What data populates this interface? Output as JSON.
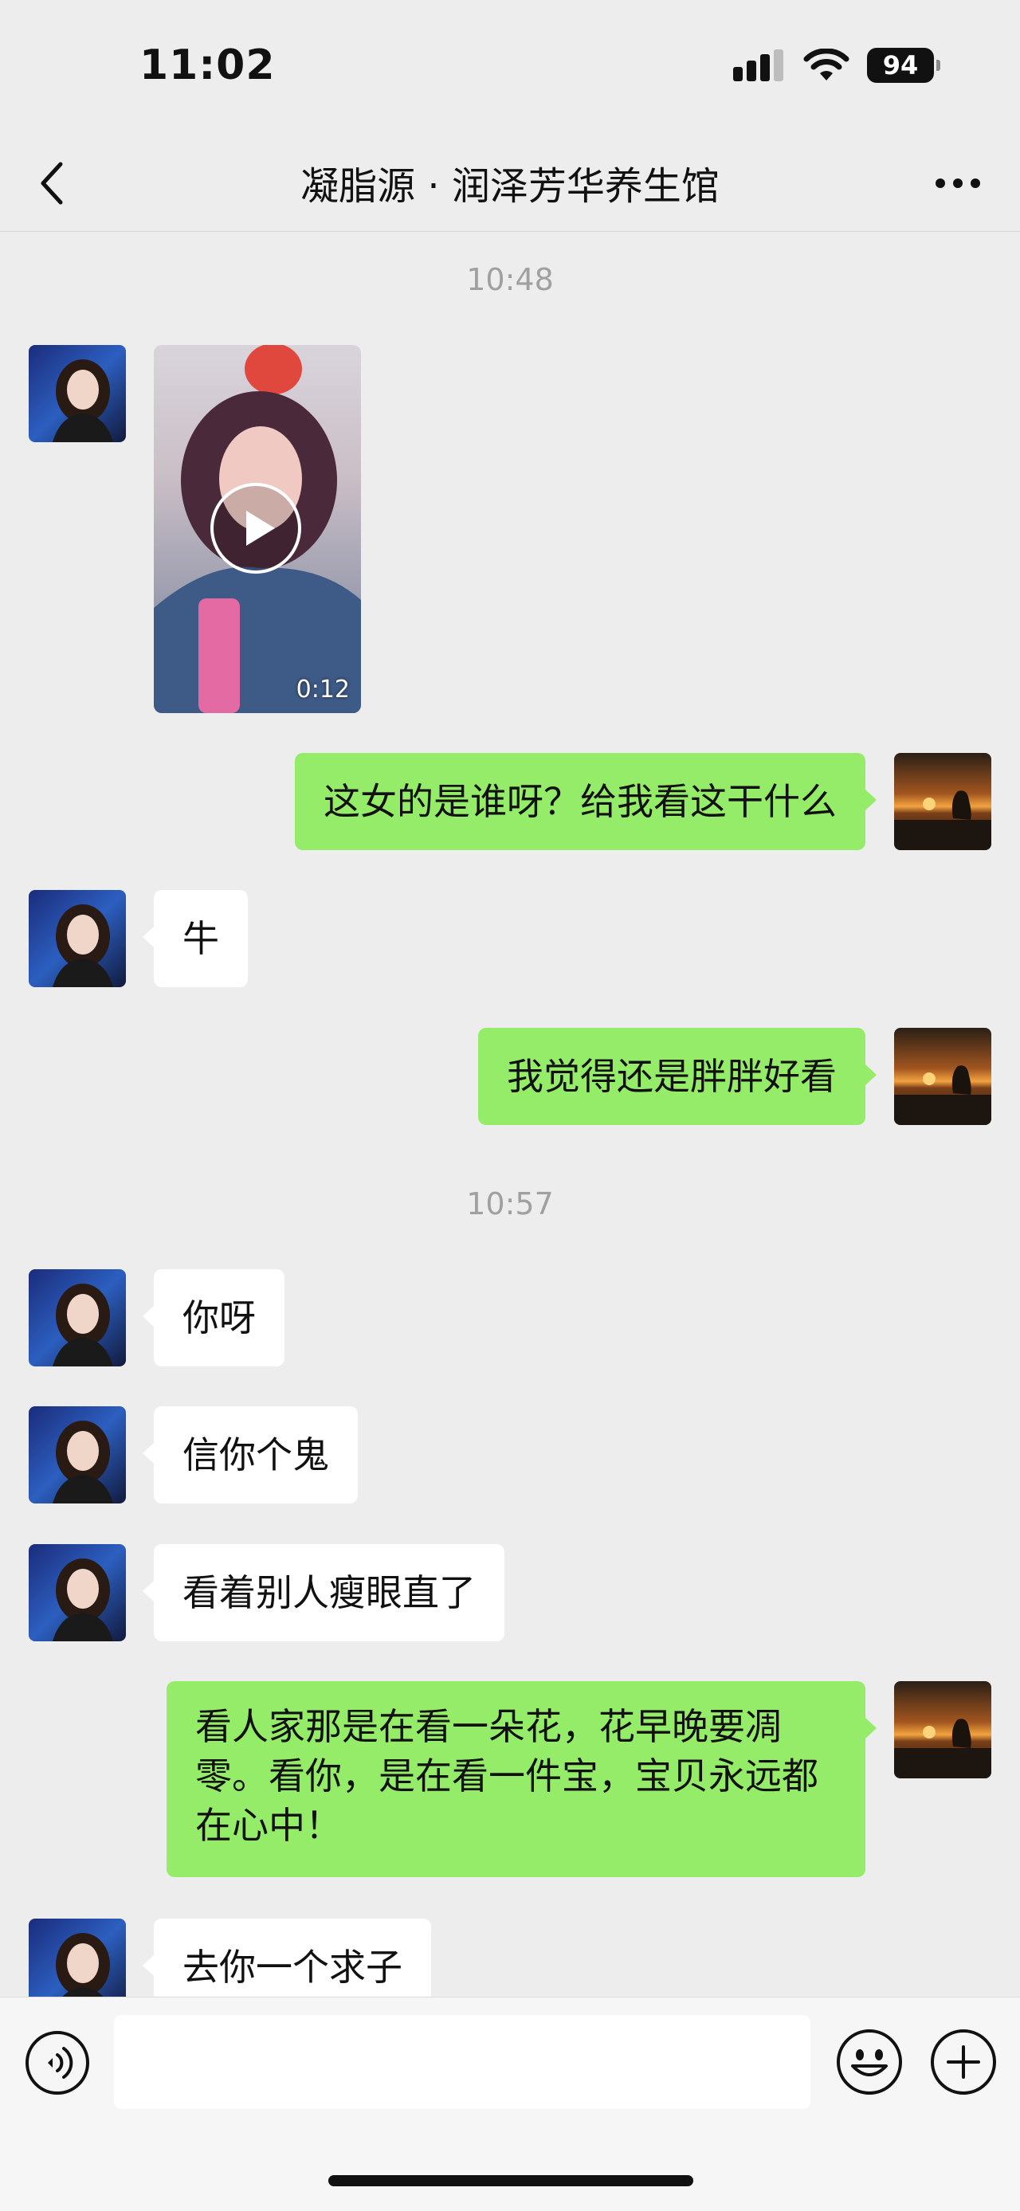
{
  "status_bar": {
    "time": "11:02",
    "battery": "94"
  },
  "nav": {
    "title": "凝脂源 · 润泽芳华养生馆"
  },
  "chat": {
    "timestamps": [
      "10:48",
      "10:57"
    ],
    "video": {
      "duration": "0:12"
    },
    "messages": [
      {
        "side": "right",
        "text": "这女的是谁呀？给我看这干什么"
      },
      {
        "side": "left",
        "text": "牛"
      },
      {
        "side": "right",
        "text": "我觉得还是胖胖好看"
      },
      {
        "side": "left",
        "text": "你呀"
      },
      {
        "side": "left",
        "text": "信你个鬼"
      },
      {
        "side": "left",
        "text": "看着别人瘦眼直了"
      },
      {
        "side": "right",
        "text": "看人家那是在看一朵花，花早晚要凋零。看你，是在看一件宝，宝贝永远都在心中！"
      },
      {
        "side": "left",
        "text": "去你一个求子"
      }
    ]
  },
  "input": {
    "value": ""
  },
  "colors": {
    "background": "#EDEDED",
    "bubble_self": "#95EC69",
    "bubble_other": "#FFFFFF",
    "timestamp": "#A0A0A0"
  },
  "icons": {
    "back": "chevron-left-icon",
    "more": "more-icon",
    "voice": "voice-icon",
    "emoji": "emoji-icon",
    "plus": "plus-icon",
    "play": "play-icon"
  }
}
